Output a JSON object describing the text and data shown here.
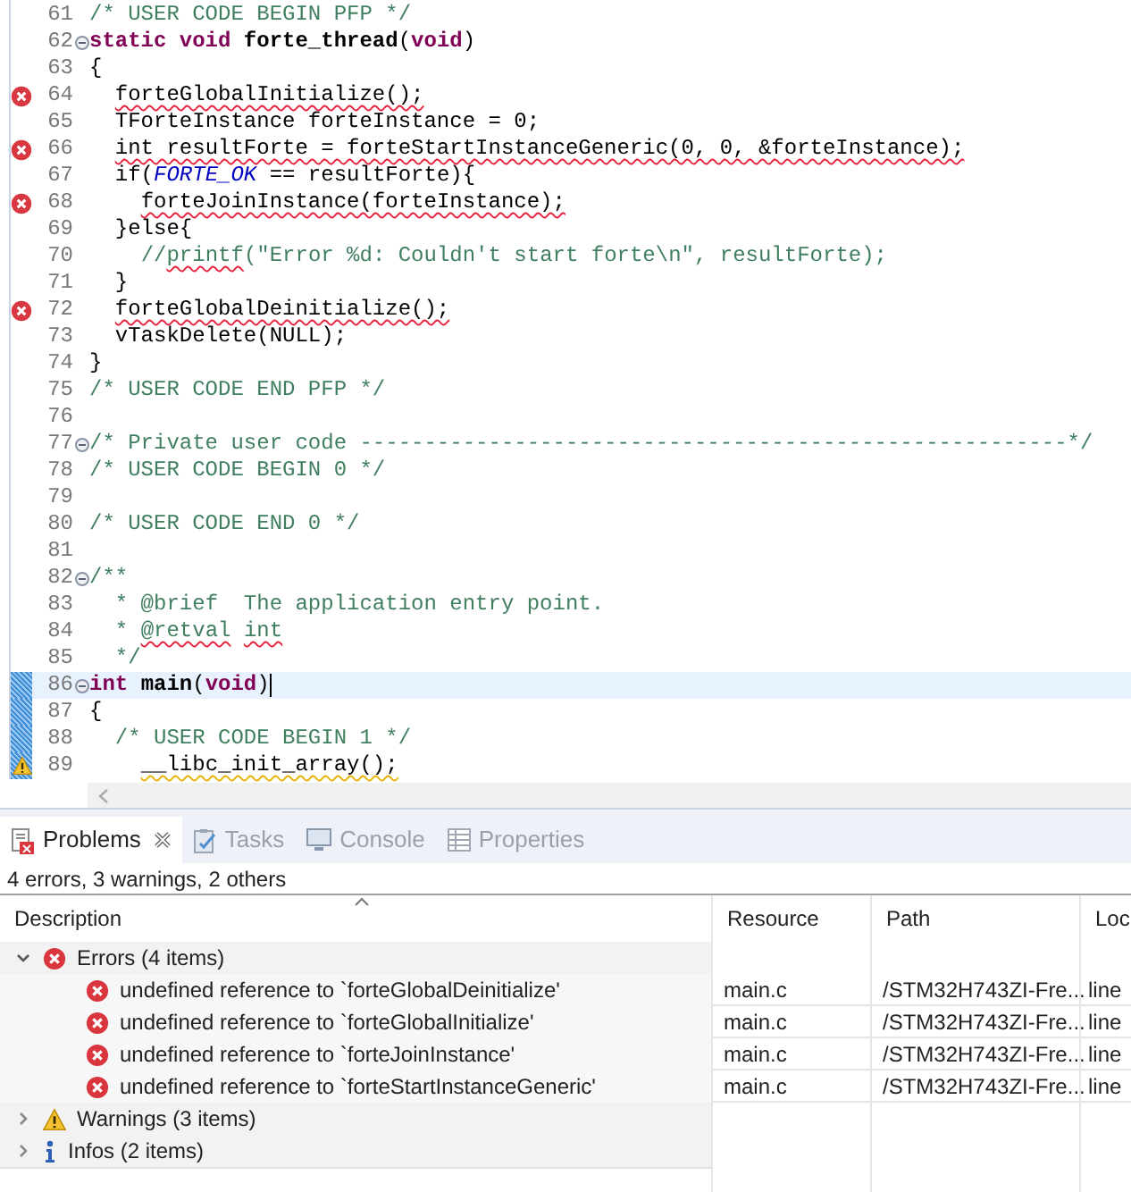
{
  "editor": {
    "lines": [
      {
        "number": "61",
        "kind": "plain",
        "fold": false,
        "current": false,
        "range": false,
        "tokens": [
          {
            "text": "/* USER CODE BEGIN PFP */",
            "kind": "comment"
          }
        ]
      },
      {
        "number": "62",
        "kind": "plain",
        "fold": true,
        "current": false,
        "range": false,
        "tokens": [
          {
            "text": "static void ",
            "kind": "keyword"
          },
          {
            "text": "forte_thread",
            "kind": "bold"
          },
          {
            "text": "(",
            "kind": "plain"
          },
          {
            "text": "void",
            "kind": "keyword"
          },
          {
            "text": ")",
            "kind": "plain"
          }
        ]
      },
      {
        "number": "63",
        "kind": "plain",
        "fold": false,
        "current": false,
        "range": false,
        "tokens": [
          {
            "text": "{",
            "kind": "plain"
          }
        ]
      },
      {
        "number": "64",
        "kind": "error",
        "fold": false,
        "current": false,
        "range": false,
        "tokens": [
          {
            "text": "  forteGlobalInitialize();",
            "kind": "plain",
            "error_underline": true
          }
        ]
      },
      {
        "number": "65",
        "kind": "plain",
        "fold": false,
        "current": false,
        "range": false,
        "tokens": [
          {
            "text": "  TForteInstance forteInstance = 0;",
            "kind": "plain"
          }
        ]
      },
      {
        "number": "66",
        "kind": "error",
        "fold": false,
        "current": false,
        "range": false,
        "tokens": [
          {
            "text": "  int resultForte = forteStartInstanceGeneric(0, 0, &forteInstance);",
            "kind": "plain",
            "error_underline": true
          }
        ]
      },
      {
        "number": "67",
        "kind": "plain",
        "fold": false,
        "current": false,
        "range": false,
        "tokens": [
          {
            "text": "  if(",
            "kind": "plain"
          },
          {
            "text": "FORTE_OK",
            "kind": "macro"
          },
          {
            "text": " == resultForte){",
            "kind": "plain"
          }
        ]
      },
      {
        "number": "68",
        "kind": "error",
        "fold": false,
        "current": false,
        "range": false,
        "tokens": [
          {
            "text": "    forteJoinInstance(forteInstance);",
            "kind": "plain",
            "error_underline": true
          }
        ]
      },
      {
        "number": "69",
        "kind": "plain",
        "fold": false,
        "current": false,
        "range": false,
        "tokens": [
          {
            "text": "  }else{",
            "kind": "plain"
          }
        ]
      },
      {
        "number": "70",
        "kind": "plain",
        "fold": false,
        "current": false,
        "range": false,
        "tokens": [
          {
            "text": "    //",
            "kind": "comment"
          },
          {
            "text": "printf",
            "kind": "comment",
            "error_underline": true
          },
          {
            "text": "(\"Error %d: Couldn't start forte\\n\", resultForte);",
            "kind": "comment"
          }
        ]
      },
      {
        "number": "71",
        "kind": "plain",
        "fold": false,
        "current": false,
        "range": false,
        "tokens": [
          {
            "text": "  }",
            "kind": "plain"
          }
        ]
      },
      {
        "number": "72",
        "kind": "error",
        "fold": false,
        "current": false,
        "range": false,
        "tokens": [
          {
            "text": "  forteGlobalDeinitialize();",
            "kind": "plain",
            "error_underline": true
          }
        ]
      },
      {
        "number": "73",
        "kind": "plain",
        "fold": false,
        "current": false,
        "range": false,
        "tokens": [
          {
            "text": "  vTaskDelete(NULL);",
            "kind": "plain"
          }
        ]
      },
      {
        "number": "74",
        "kind": "plain",
        "fold": false,
        "current": false,
        "range": false,
        "tokens": [
          {
            "text": "}",
            "kind": "plain"
          }
        ]
      },
      {
        "number": "75",
        "kind": "plain",
        "fold": false,
        "current": false,
        "range": false,
        "tokens": [
          {
            "text": "/* USER CODE END PFP */",
            "kind": "comment"
          }
        ]
      },
      {
        "number": "76",
        "kind": "plain",
        "fold": false,
        "current": false,
        "range": false
      },
      {
        "number": "77",
        "kind": "plain",
        "fold": true,
        "current": false,
        "range": false,
        "tokens": [
          {
            "text": "/* Private user code -------------------------------------------------------*/",
            "kind": "comment"
          }
        ]
      },
      {
        "number": "78",
        "kind": "plain",
        "fold": false,
        "current": false,
        "range": false,
        "tokens": [
          {
            "text": "/* USER CODE BEGIN 0 */",
            "kind": "comment"
          }
        ]
      },
      {
        "number": "79",
        "kind": "plain",
        "fold": false,
        "current": false,
        "range": false
      },
      {
        "number": "80",
        "kind": "plain",
        "fold": false,
        "current": false,
        "range": false,
        "tokens": [
          {
            "text": "/* USER CODE END 0 */",
            "kind": "comment"
          }
        ]
      },
      {
        "number": "81",
        "kind": "plain",
        "fold": false,
        "current": false,
        "range": false
      },
      {
        "number": "82",
        "kind": "plain",
        "fold": true,
        "current": false,
        "range": false,
        "tokens": [
          {
            "text": "/**",
            "kind": "comment"
          }
        ]
      },
      {
        "number": "83",
        "kind": "plain",
        "fold": false,
        "current": false,
        "range": false,
        "tokens": [
          {
            "text": "  * @brief  The application entry point.",
            "kind": "comment"
          }
        ]
      },
      {
        "number": "84",
        "kind": "plain",
        "fold": false,
        "current": false,
        "range": false,
        "tokens": [
          {
            "text": "  * ",
            "kind": "comment"
          },
          {
            "text": "@retval",
            "kind": "comment",
            "error_underline": true
          },
          {
            "text": " int",
            "kind": "comment",
            "error_underline": true
          }
        ]
      },
      {
        "number": "85",
        "kind": "plain",
        "fold": false,
        "current": false,
        "range": false,
        "tokens": [
          {
            "text": "  */",
            "kind": "comment"
          }
        ]
      },
      {
        "number": "86",
        "kind": "plain",
        "fold": true,
        "current": true,
        "range": true,
        "tokens": [
          {
            "text": "int ",
            "kind": "keyword"
          },
          {
            "text": "main",
            "kind": "bold"
          },
          {
            "text": "(",
            "kind": "plain"
          },
          {
            "text": "void",
            "kind": "keyword"
          },
          {
            "text": ")",
            "kind": "plain"
          }
        ]
      },
      {
        "number": "87",
        "kind": "plain",
        "fold": false,
        "current": false,
        "range": true,
        "tokens": [
          {
            "text": "{",
            "kind": "plain"
          }
        ]
      },
      {
        "number": "88",
        "kind": "plain",
        "fold": false,
        "current": false,
        "range": true,
        "tokens": [
          {
            "text": "  /* USER CODE BEGIN 1 */",
            "kind": "comment"
          }
        ]
      },
      {
        "number": "89",
        "kind": "warning",
        "fold": false,
        "current": false,
        "range": true,
        "tokens": [
          {
            "text": "    __libc_init_array();",
            "kind": "plain",
            "warning_underline": true
          }
        ]
      }
    ]
  },
  "views": {
    "tabs": [
      {
        "label": "Problems",
        "selected": true,
        "kind": "problems",
        "closable": true
      },
      {
        "label": "Tasks",
        "selected": false,
        "kind": "tasks",
        "closable": false
      },
      {
        "label": "Console",
        "selected": false,
        "kind": "console",
        "closable": false
      },
      {
        "label": "Properties",
        "selected": false,
        "kind": "properties",
        "closable": false
      }
    ],
    "summary": "4 errors, 3 warnings, 2 others",
    "table": {
      "columns": [
        "Description",
        "Resource",
        "Path",
        "Loc"
      ],
      "groups": [
        {
          "label": "Errors (4 items)",
          "kind": "error",
          "expanded": true,
          "children": [
            {
              "description": "undefined reference to `forteGlobalDeinitialize'",
              "resource": "main.c",
              "path": "/STM32H743ZI-Fre...",
              "location": "line"
            },
            {
              "description": "undefined reference to `forteGlobalInitialize'",
              "resource": "main.c",
              "path": "/STM32H743ZI-Fre...",
              "location": "line"
            },
            {
              "description": "undefined reference to `forteJoinInstance'",
              "resource": "main.c",
              "path": "/STM32H743ZI-Fre...",
              "location": "line"
            },
            {
              "description": "undefined reference to `forteStartInstanceGeneric'",
              "resource": "main.c",
              "path": "/STM32H743ZI-Fre...",
              "location": "line"
            }
          ]
        },
        {
          "label": "Warnings (3 items)",
          "kind": "warning",
          "expanded": false
        },
        {
          "label": "Infos (2 items)",
          "kind": "info",
          "expanded": false
        }
      ]
    }
  }
}
